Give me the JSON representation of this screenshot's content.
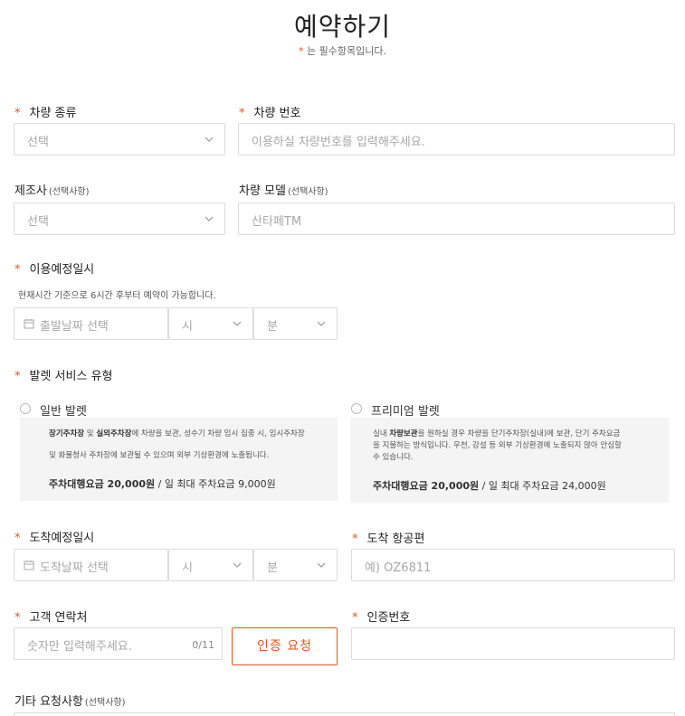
{
  "header": {
    "title": "예약하기",
    "required_mark": "*",
    "required_note": " 는 필수항목입니다."
  },
  "required_star": "*",
  "optional_tag": "(선택사항)",
  "vehicle_type": {
    "label": "차량 종류",
    "placeholder": "선택"
  },
  "vehicle_number": {
    "label": "차량 번호",
    "placeholder": "이용하실 차량번호를 입력해주세요."
  },
  "manufacturer": {
    "label": "제조사",
    "placeholder": "선택"
  },
  "vehicle_model": {
    "label": "차량 모델",
    "placeholder": "산타페TM"
  },
  "use_datetime": {
    "label": "이용예정일시",
    "note": "현재시간 기준으로 6시간 후부터 예약이 가능합니다.",
    "date_placeholder": "출발날짜 선택",
    "hour_placeholder": "시",
    "minute_placeholder": "분"
  },
  "valet_service": {
    "label": "발렛 서비스 유형",
    "options": [
      {
        "name": "일반 발렛",
        "desc_bold_1": "장기주차장",
        "desc_mid": " 및 ",
        "desc_bold_2": "실외주차장",
        "desc_rest": "에 차량을 보관, 성수기 차량 임시 집중 시, 임시주차장",
        "desc_line2": "및 화물청사 주차장에 보관될 수 있으며 외부 기상환경에 노출됩니다.",
        "price_bold": "주차대행요금 20,000원",
        "price_rest": " / 일 최대 주차요금 9,000원"
      },
      {
        "name": "프리미엄 발렛",
        "desc_pre": "실내 ",
        "desc_bold": "차량보관",
        "desc_rest": "을 원하실 경우 차량을 단기주차장(실내)에 보관, 단기 주차요금",
        "desc_line2": "을 지불하는 방식입니다. 우천, 강설 등 외부 기상환경에 노출되지 않아 안심할",
        "desc_line3": "수 있습니다.",
        "price_bold": "주차대행요금 20,000원",
        "price_rest": " / 일 최대 주차요금 24,000원"
      }
    ]
  },
  "arrival_datetime": {
    "label": "도착예정일시",
    "date_placeholder": "도착날짜 선택",
    "hour_placeholder": "시",
    "minute_placeholder": "분"
  },
  "arrival_flight": {
    "label": "도착 항공편",
    "placeholder": "예) OZ6811"
  },
  "contact": {
    "label": "고객 연락처",
    "placeholder": "숫자만 입력해주세요.",
    "counter": "0/11",
    "button": "인증 요청"
  },
  "auth_code": {
    "label": "인증번호",
    "placeholder": ""
  },
  "other_requests": {
    "label": "기타 요청사항"
  },
  "colors": {
    "accent": "#e9541c",
    "border": "#dcdcdc",
    "panel": "#f4f4f4"
  }
}
